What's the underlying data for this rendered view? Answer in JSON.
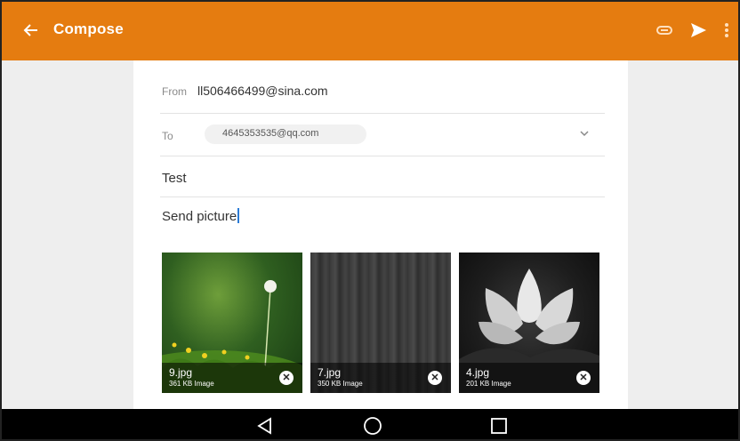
{
  "app_bar": {
    "title": "Compose",
    "accent_color": "#e57c10",
    "icons": [
      "back-arrow-icon",
      "attach-icon",
      "send-icon",
      "more-vert-icon"
    ]
  },
  "compose": {
    "from_label": "From",
    "from_value": "ll506466499@sina.com",
    "to_label": "To",
    "to_recipient": "4645353535@qq.com",
    "subject": "Test",
    "body": "Send picture"
  },
  "attachments": [
    {
      "name": "9.jpg",
      "size": "361 KB Image"
    },
    {
      "name": "7.jpg",
      "size": "350 KB Image"
    },
    {
      "name": "4.jpg",
      "size": "201 KB Image"
    }
  ],
  "nav_bar": {
    "icons": [
      "nav-back-icon",
      "nav-home-icon",
      "nav-recents-icon"
    ]
  }
}
